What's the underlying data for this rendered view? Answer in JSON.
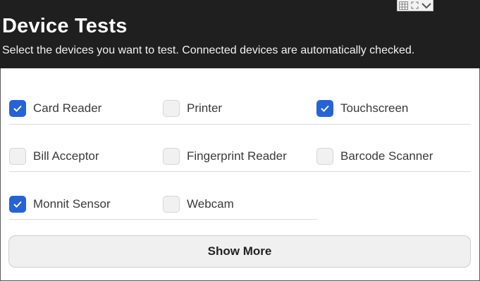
{
  "header": {
    "title": "Device Tests",
    "subtitle": "Select the devices you want to test. Connected devices are automatically checked."
  },
  "window_controls": [
    "grid-icon",
    "expand-icon",
    "chevron-down-icon"
  ],
  "devices": [
    {
      "label": "Card Reader",
      "checked": true
    },
    {
      "label": "Printer",
      "checked": false
    },
    {
      "label": "Touchscreen",
      "checked": true
    },
    {
      "label": "Bill Acceptor",
      "checked": false
    },
    {
      "label": "Fingerprint Reader",
      "checked": false
    },
    {
      "label": "Barcode Scanner",
      "checked": false
    },
    {
      "label": "Monnit Sensor",
      "checked": true
    },
    {
      "label": "Webcam",
      "checked": false
    }
  ],
  "show_more_label": "Show More",
  "colors": {
    "header_bg": "#1f1f1f",
    "checkbox_checked": "#2563d6",
    "checkbox_unchecked": "#f1f1f1"
  }
}
